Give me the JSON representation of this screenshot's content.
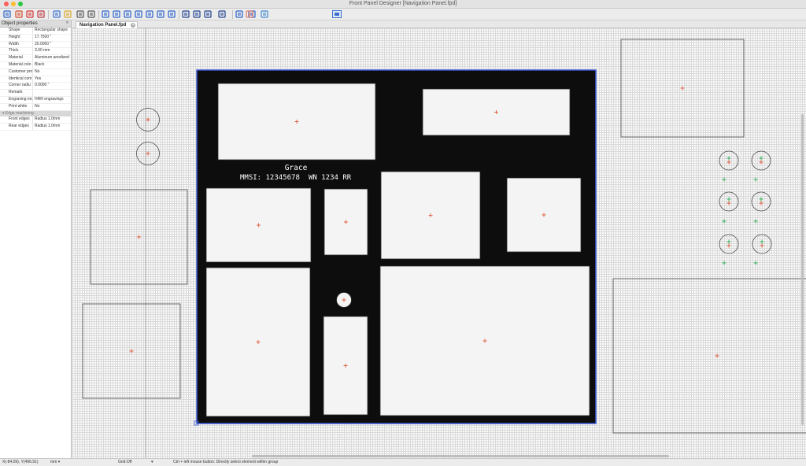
{
  "window": {
    "title": "Front Panel Designer [Navigation Panel.fpd]"
  },
  "toolbar": {
    "buttons": [
      {
        "icon": "new-document-icon",
        "color": "#2a62c9"
      },
      {
        "icon": "open-folder-icon",
        "color": "#d24a2a"
      },
      {
        "icon": "save-icon",
        "color": "#d63030"
      },
      {
        "icon": "print-icon",
        "color": "#b8353e"
      },
      {
        "icon": "pointer-icon",
        "color": "#3a6fd0"
      },
      {
        "icon": "ruler-icon",
        "color": "#d9a92a"
      },
      {
        "icon": "zoom-icon",
        "color": "#555555"
      },
      {
        "icon": "move-crosshair-icon",
        "color": "#555555"
      },
      {
        "icon": "rect-cutout-icon",
        "color": "#2a62c9"
      },
      {
        "icon": "round-cutout-icon",
        "color": "#2a62c9"
      },
      {
        "icon": "angle-cutout-icon",
        "color": "#2a62c9"
      },
      {
        "icon": "arc-cutout-icon",
        "color": "#2a62c9"
      },
      {
        "icon": "grid-cutout-icon",
        "color": "#2a62c9"
      },
      {
        "icon": "bolt-cutout-icon",
        "color": "#2a62c9"
      },
      {
        "icon": "pocket-cutout-icon",
        "color": "#2a62c9"
      },
      {
        "icon": "text-engraving-icon",
        "color": "#1f3f8f"
      },
      {
        "icon": "text-along-arc-icon",
        "color": "#1f3f8f"
      },
      {
        "icon": "edit-text-icon",
        "color": "#1f3f8f"
      },
      {
        "icon": "line-engraving-icon",
        "color": "#1f3f8f"
      },
      {
        "icon": "align-icon",
        "color": "#2a62c9"
      },
      {
        "icon": "dxf-import-icon",
        "color": "#2a62c9"
      },
      {
        "icon": "fit-view-icon",
        "color": "#3a8ad0"
      },
      {
        "icon": "price-quote-icon",
        "color": "#e07a6a"
      }
    ],
    "right_icon": "panel-preview-icon"
  },
  "properties": {
    "title": "Object properties",
    "rows": [
      {
        "key": "Shape",
        "value": "Rectangular shape"
      },
      {
        "key": "Height",
        "value": "17.7500 \""
      },
      {
        "key": "Width",
        "value": "20.0000 \""
      },
      {
        "key": "Thick.",
        "value": "3.00 mm"
      },
      {
        "key": "Material",
        "value": "Aluminum anodized"
      },
      {
        "key": "Material colo",
        "value": "Black"
      },
      {
        "key": "Customer pro",
        "value": "No"
      },
      {
        "key": "Identical com",
        "value": "Yes"
      },
      {
        "key": "Corner radiu",
        "value": "0.0000 \""
      },
      {
        "key": "Remark",
        "value": ""
      },
      {
        "key": "Engraving mo",
        "value": "HRR engravings"
      },
      {
        "key": "Print white",
        "value": "No"
      }
    ],
    "group": "Edge machining",
    "edge_rows": [
      {
        "key": "Front edges",
        "value": "Radius 1.0mm"
      },
      {
        "key": "Rear edges",
        "value": "Radius 1.0mm"
      }
    ]
  },
  "tabs": [
    {
      "label": "Navigation Panel.fpd"
    }
  ],
  "panel": {
    "color": "#0d0d0d",
    "selection_color": "#3b5bd6",
    "engraving": {
      "name": "Grace",
      "mmsi": "MMSI: 12345678",
      "wn": "WN  1234  RR"
    }
  },
  "status": {
    "coords": "X(-84.09), Y(496.91)",
    "unit": "mm",
    "grid": "Grid:Off",
    "hint": "Ctrl + left mouse button: Directly select element within group"
  },
  "colors": {
    "cutout_fill": "#f4f4f4",
    "outline": "#4a4a4a",
    "center_mark": "#e05a3a",
    "alt_mark": "#35b05a"
  }
}
